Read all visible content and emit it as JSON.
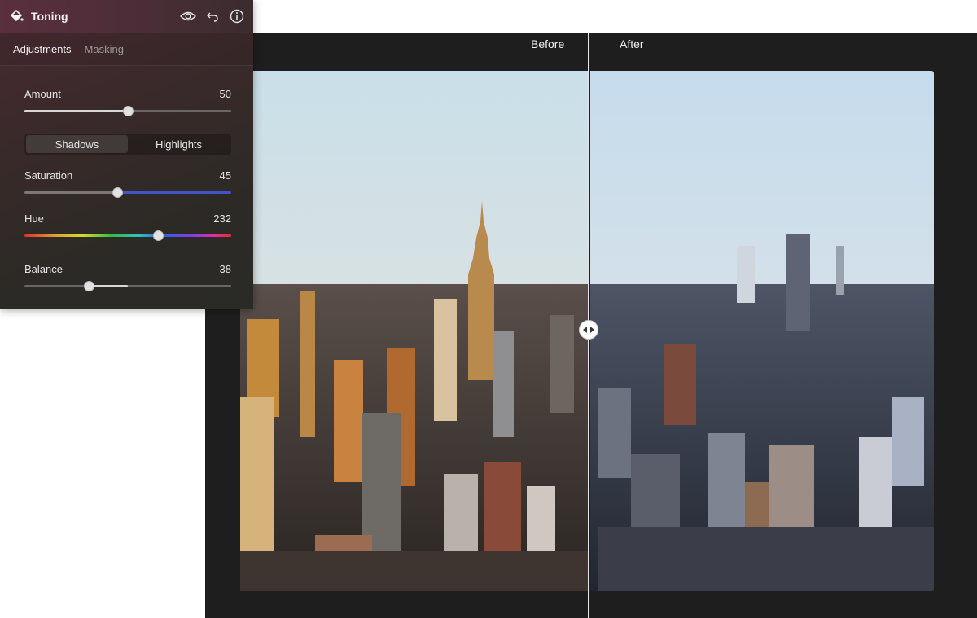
{
  "panel": {
    "title": "Toning",
    "icons": [
      "paint-bucket-icon",
      "eye-icon",
      "undo-icon",
      "info-icon"
    ],
    "tabs": [
      {
        "label": "Adjustments",
        "active": true
      },
      {
        "label": "Masking",
        "active": false
      }
    ],
    "amount": {
      "label": "Amount",
      "value": "50",
      "level": 0.5
    },
    "toggle": {
      "shadows": "Shadows",
      "highlights": "Highlights",
      "selected": "Shadows"
    },
    "saturation": {
      "label": "Saturation",
      "value": "45",
      "level": 0.45
    },
    "hue": {
      "label": "Hue",
      "value": "232",
      "level": 0.645
    },
    "balance": {
      "label": "Balance",
      "value": "-38",
      "level": 0.31
    }
  },
  "compare": {
    "before_label": "Before",
    "after_label": "After"
  },
  "colors": {
    "accent": "#e2e2e2",
    "saturation_track": "#3f55c9",
    "sky_top": "#c6dbe6",
    "sky_horizon": "#e9d6bf"
  }
}
